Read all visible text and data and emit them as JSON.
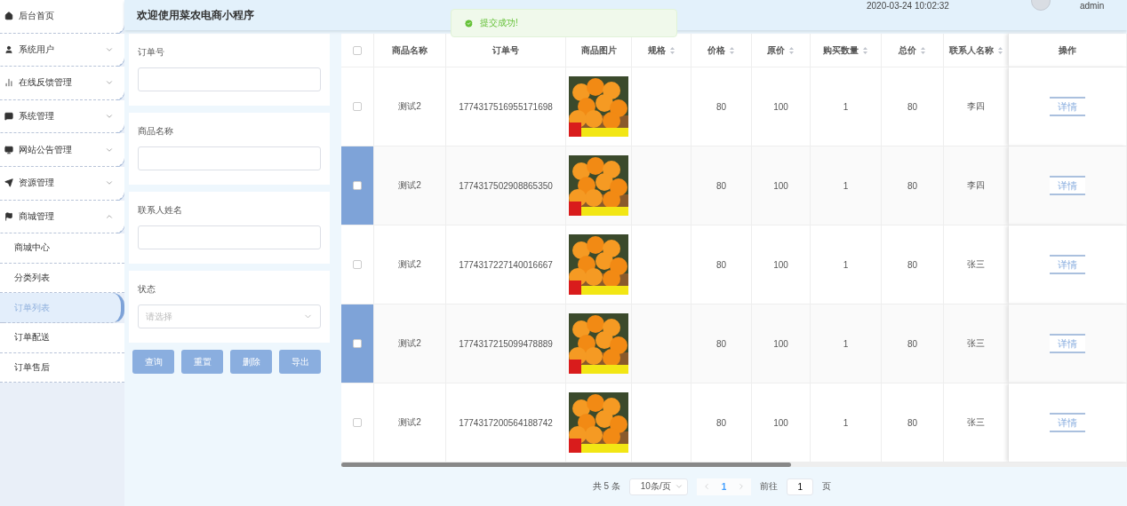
{
  "header": {
    "title": "欢迎使用菜农电商小程序",
    "datetime": "2020-03-24 10:02:32",
    "user": "admin"
  },
  "toast": {
    "message": "提交成功!"
  },
  "sidebar": {
    "items": [
      {
        "label": "后台首页"
      },
      {
        "label": "系统用户",
        "expanded": false
      },
      {
        "label": "在线反馈管理",
        "expanded": false
      },
      {
        "label": "系统管理",
        "expanded": false
      },
      {
        "label": "网站公告管理",
        "expanded": false
      },
      {
        "label": "资源管理",
        "expanded": false
      },
      {
        "label": "商城管理",
        "expanded": true,
        "children": [
          {
            "label": "商城中心",
            "selected": false
          },
          {
            "label": "分类列表",
            "selected": false
          },
          {
            "label": "订单列表",
            "selected": true
          },
          {
            "label": "订单配送",
            "selected": false
          },
          {
            "label": "订单售后",
            "selected": false
          }
        ]
      }
    ]
  },
  "search": {
    "fields": [
      {
        "kind": "input",
        "label": "订单号"
      },
      {
        "kind": "input",
        "label": "商品名称"
      },
      {
        "kind": "input",
        "label": "联系人姓名"
      },
      {
        "kind": "select",
        "label": "状态",
        "placeholder": "请选择"
      }
    ],
    "buttons": [
      "查询",
      "重置",
      "删除",
      "导出"
    ]
  },
  "table": {
    "select_all_checked": false,
    "columns": [
      {
        "label": "商品名称",
        "sortable": false
      },
      {
        "label": "订单号",
        "sortable": false
      },
      {
        "label": "商品图片",
        "sortable": false
      },
      {
        "label": "规格",
        "sortable": true
      },
      {
        "label": "价格",
        "sortable": true
      },
      {
        "label": "原价",
        "sortable": true
      },
      {
        "label": "购买数量",
        "sortable": true
      },
      {
        "label": "总价",
        "sortable": true
      },
      {
        "label": "联系人名称",
        "sortable": true
      },
      {
        "label": "操作",
        "sortable": false
      }
    ],
    "rows": [
      {
        "selected": false,
        "name": "测试2",
        "order_no": "1774317516955171698",
        "price": "80",
        "original_price": "100",
        "quantity": "1",
        "total": "80",
        "contact": "李四",
        "action": "详情"
      },
      {
        "selected": true,
        "name": "测试2",
        "order_no": "1774317502908865350",
        "price": "80",
        "original_price": "100",
        "quantity": "1",
        "total": "80",
        "contact": "李四",
        "action": "详情"
      },
      {
        "selected": false,
        "name": "测试2",
        "order_no": "1774317227140016667",
        "price": "80",
        "original_price": "100",
        "quantity": "1",
        "total": "80",
        "contact": "张三",
        "action": "详情"
      },
      {
        "selected": true,
        "name": "测试2",
        "order_no": "1774317215099478889",
        "price": "80",
        "original_price": "100",
        "quantity": "1",
        "total": "80",
        "contact": "张三",
        "action": "详情"
      },
      {
        "selected": false,
        "name": "测试2",
        "order_no": "1774317200564188742",
        "price": "80",
        "original_price": "100",
        "quantity": "1",
        "total": "80",
        "contact": "张三",
        "action": "详情"
      }
    ]
  },
  "pagination": {
    "total": "共 5 条",
    "page_size": "10条/页",
    "pages": [
      {
        "label": "1",
        "selected": true
      }
    ],
    "goto_label": "前往",
    "goto_value": "1",
    "goto_suffix": "页"
  }
}
